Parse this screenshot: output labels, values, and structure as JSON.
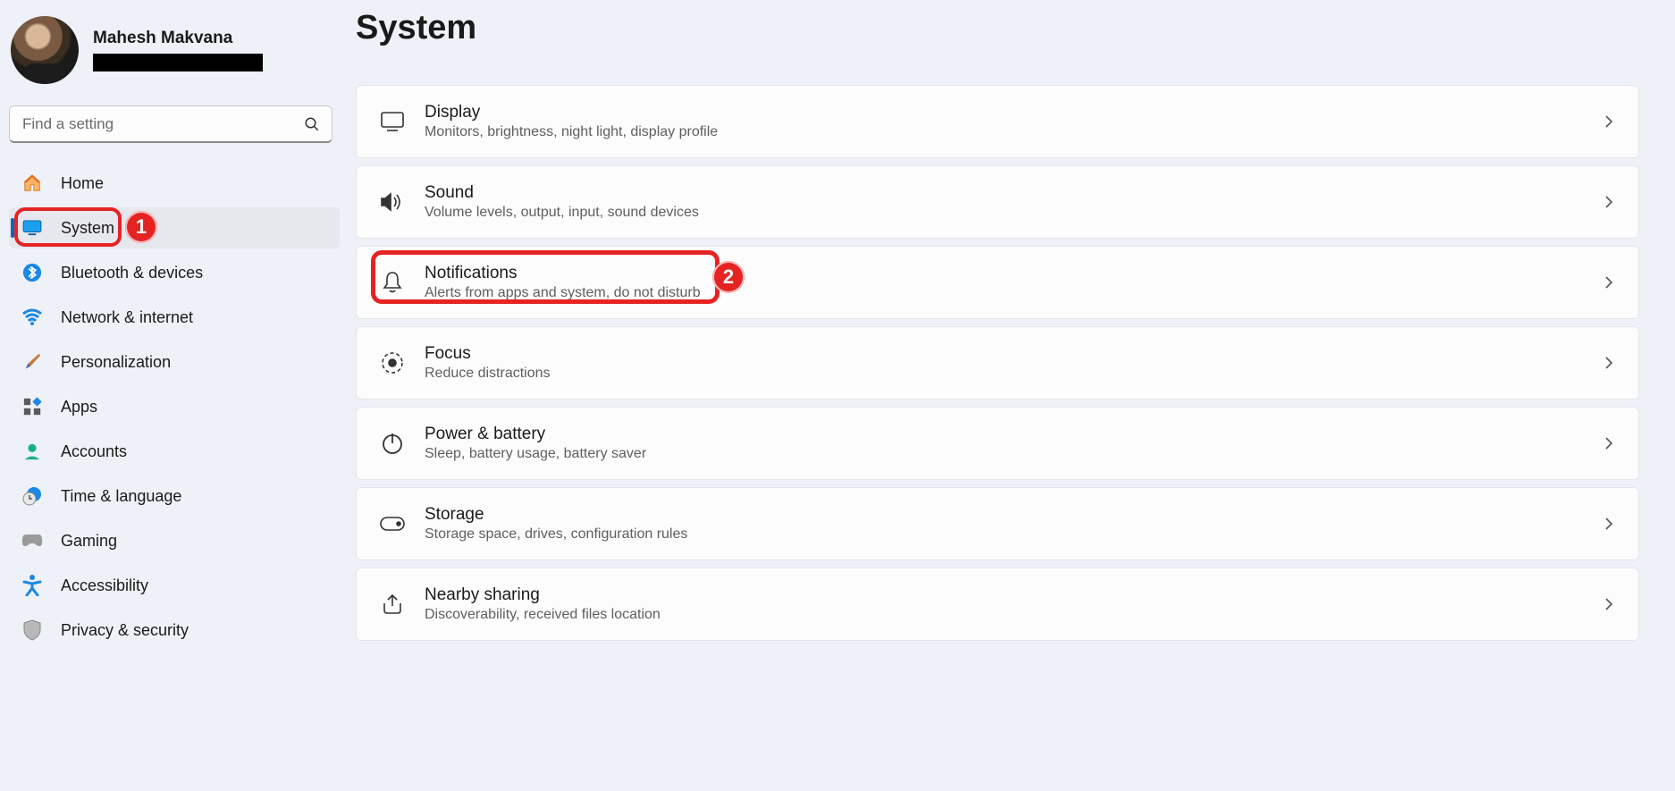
{
  "profile": {
    "name": "Mahesh Makvana"
  },
  "search": {
    "placeholder": "Find a setting"
  },
  "nav": [
    {
      "label": "Home"
    },
    {
      "label": "System"
    },
    {
      "label": "Bluetooth & devices"
    },
    {
      "label": "Network & internet"
    },
    {
      "label": "Personalization"
    },
    {
      "label": "Apps"
    },
    {
      "label": "Accounts"
    },
    {
      "label": "Time & language"
    },
    {
      "label": "Gaming"
    },
    {
      "label": "Accessibility"
    },
    {
      "label": "Privacy & security"
    }
  ],
  "page": {
    "title": "System"
  },
  "cards": [
    {
      "title": "Display",
      "desc": "Monitors, brightness, night light, display profile"
    },
    {
      "title": "Sound",
      "desc": "Volume levels, output, input, sound devices"
    },
    {
      "title": "Notifications",
      "desc": "Alerts from apps and system, do not disturb"
    },
    {
      "title": "Focus",
      "desc": "Reduce distractions"
    },
    {
      "title": "Power & battery",
      "desc": "Sleep, battery usage, battery saver"
    },
    {
      "title": "Storage",
      "desc": "Storage space, drives, configuration rules"
    },
    {
      "title": "Nearby sharing",
      "desc": "Discoverability, received files location"
    }
  ],
  "annotations": {
    "badge1": "1",
    "badge2": "2"
  }
}
